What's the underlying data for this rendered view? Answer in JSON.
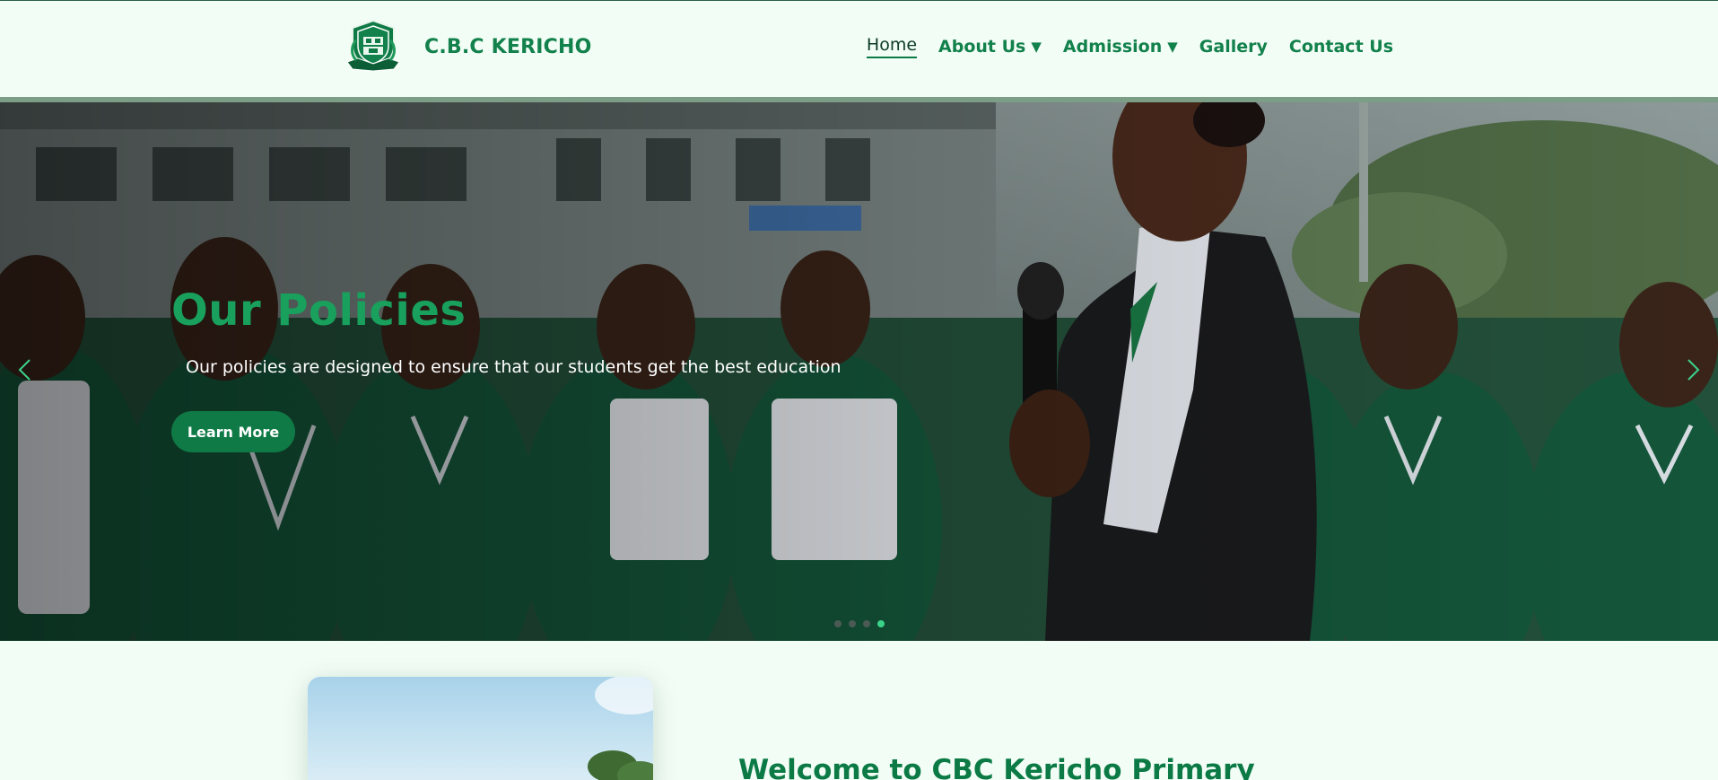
{
  "header": {
    "brand": "C.B.C KERICHO",
    "logo_icon": "school-crest-icon",
    "nav": {
      "home": "Home",
      "about": "About Us",
      "admission": "Admission",
      "gallery": "Gallery",
      "contact": "Contact Us",
      "dropdown_caret": "▼"
    }
  },
  "hero": {
    "title": "Our Policies",
    "text": "Our policies are designed to ensure that our students get the best education",
    "button": "Learn More",
    "prev_icon": "chevron-left-icon",
    "next_icon": "chevron-right-icon",
    "slides_total": 4,
    "active_slide": 4
  },
  "welcome": {
    "title": "Welcome to CBC Kericho Primary"
  },
  "colors": {
    "brand_green": "#12814b",
    "accent_green": "#18a05c",
    "background": "#f2fdf6",
    "active_dot": "#3bd28a"
  }
}
